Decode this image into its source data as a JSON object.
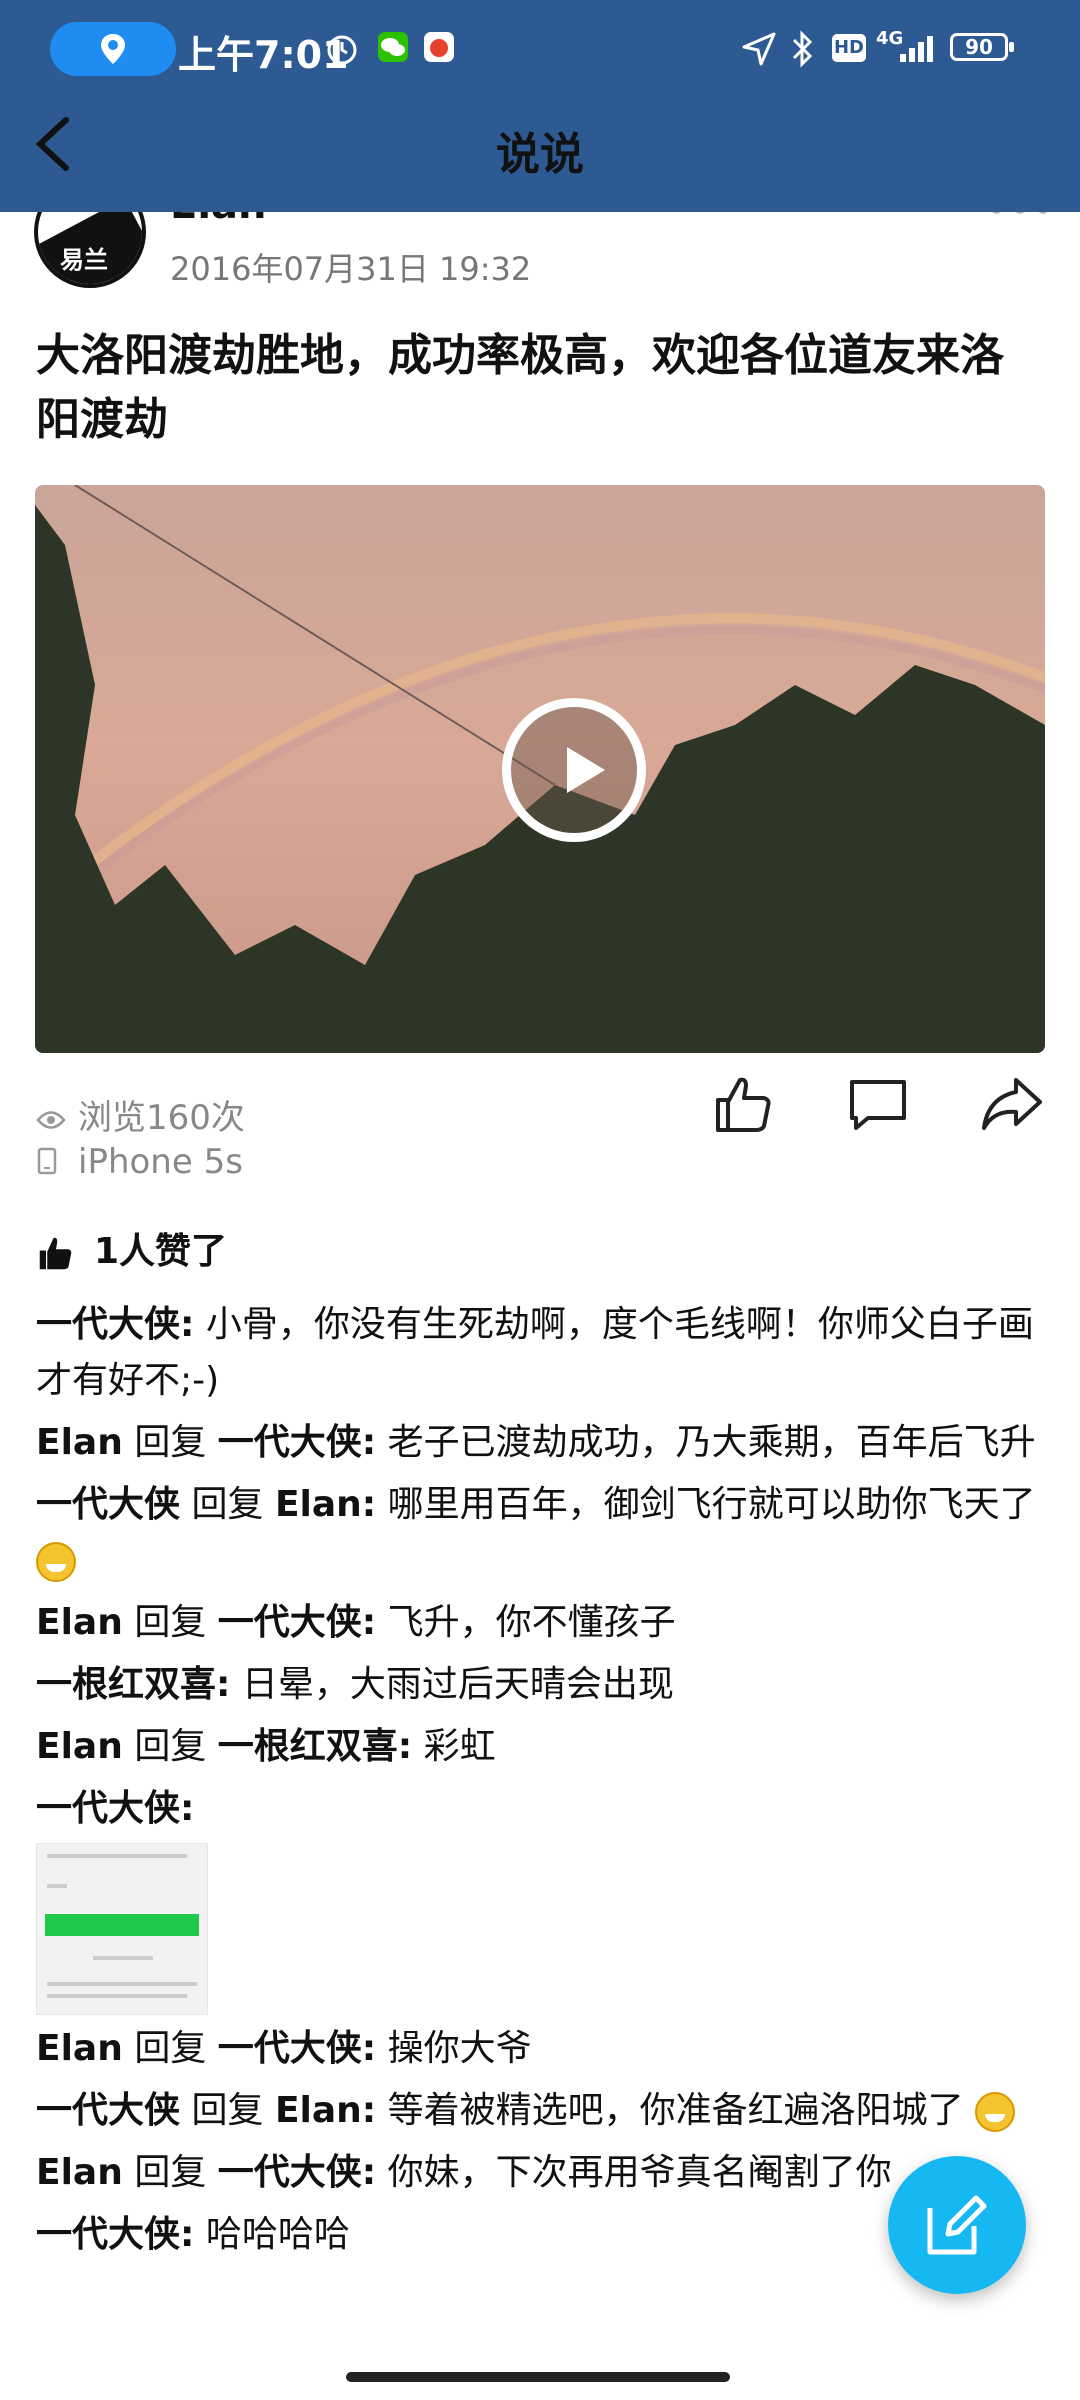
{
  "status_bar": {
    "time": "上午7:01",
    "network": "4G",
    "hd": "HD",
    "battery": "90"
  },
  "header": {
    "title": "说说"
  },
  "post": {
    "author": "Elan",
    "avatar_text": "易兰",
    "date": "2016年07月31日 19:32",
    "text": "大洛阳渡劫胜地，成功率极高，欢迎各位道友来洛阳渡劫",
    "views": "浏览160次",
    "device": "iPhone 5s"
  },
  "likes": {
    "text": "1人赞了"
  },
  "comments": [
    {
      "author": "一代大侠:",
      "reply": "",
      "target": "",
      "text": "小骨，你没有生死劫啊，度个毛线啊！你师父白子画才有好不;-)"
    },
    {
      "author": "Elan",
      "reply": "回复",
      "target": "一代大侠:",
      "text": "老子已渡劫成功，乃大乘期，百年后飞升"
    },
    {
      "author": "一代大侠",
      "reply": "回复",
      "target": "Elan:",
      "text": "哪里用百年，御剑飞行就可以助你飞天了"
    },
    {
      "author": "Elan",
      "reply": "回复",
      "target": "一代大侠:",
      "text": "飞升，你不懂孩子"
    },
    {
      "author": "一根红双喜:",
      "reply": "",
      "target": "",
      "text": "日晕，大雨过后天晴会出现"
    },
    {
      "author": "Elan",
      "reply": "回复",
      "target": "一根红双喜:",
      "text": "彩虹"
    },
    {
      "author": "一代大侠:",
      "reply": "",
      "target": "",
      "text": ""
    },
    {
      "author": "Elan",
      "reply": "回复",
      "target": "一代大侠:",
      "text": "操你大爷"
    },
    {
      "author": "一代大侠",
      "reply": "回复",
      "target": "Elan:",
      "text": "等着被精选吧，你准备红遍洛阳城了"
    },
    {
      "author": "Elan",
      "reply": "回复",
      "target": "一代大侠:",
      "text": "你妹，下次再用爷真名阉割了你"
    },
    {
      "author": "一代大侠:",
      "reply": "",
      "target": "",
      "text": "哈哈哈哈"
    }
  ],
  "icons": {
    "location": "location-icon",
    "back": "back-arrow-icon",
    "like": "thumbs-up-icon",
    "comment": "comment-icon",
    "share": "share-icon",
    "edit": "edit-icon",
    "play": "play-icon"
  },
  "colors": {
    "header_bg": "#2d5a93",
    "fab": "#15b8f0",
    "accent_pill": "#1e8cf0"
  }
}
